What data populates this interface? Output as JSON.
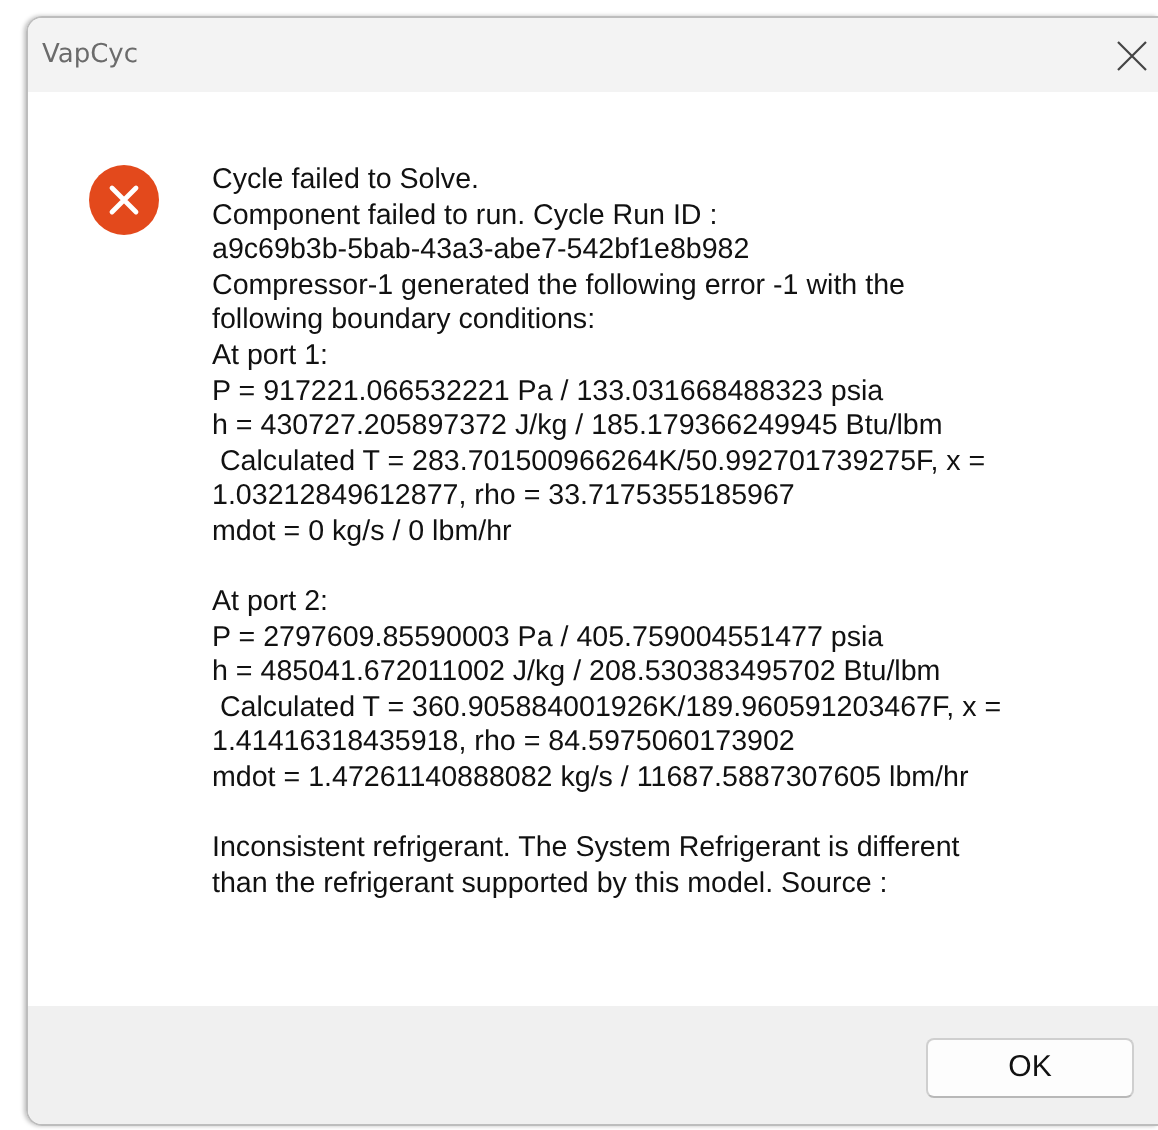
{
  "window": {
    "title": "VapCyc"
  },
  "message": {
    "kind": "error",
    "paragraphs": [
      "Cycle failed to Solve.\nComponent failed to run. Cycle Run ID :\na9c69b3b-5bab-43a3-abe7-542bf1e8b982\nCompressor-1 generated the following error -1 with the\nfollowing boundary conditions:\nAt port 1:\nP = 917221.066532221 Pa / 133.031668488323 psia\nh = 430727.205897372 J/kg / 185.179366249945 Btu/lbm\n Calculated T = 283.701500966264K/50.992701739275F, x =\n1.03212849612877, rho = 33.7175355185967\nmdot = 0 kg/s / 0 lbm/hr",
      "At port 2:\nP = 2797609.85590003 Pa / 405.759004551477 psia\nh = 485041.672011002 J/kg / 208.530383495702 Btu/lbm\n Calculated T = 360.905884001926K/189.960591203467F, x =\n1.41416318435918, rho = 84.5975060173902\nmdot = 1.47261140888082 kg/s / 11687.5887307605 lbm/hr",
      "Inconsistent refrigerant. The System Refrigerant is different\nthan the refrigerant supported by this model. Source :"
    ]
  },
  "buttons": [
    "OK"
  ]
}
